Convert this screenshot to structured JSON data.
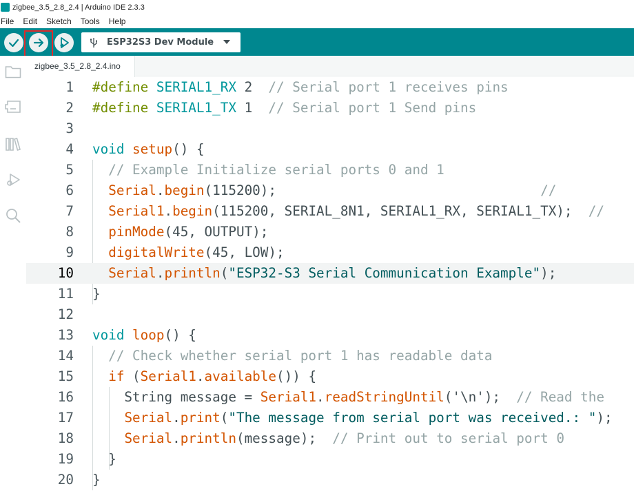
{
  "window": {
    "title": "zigbee_3.5_2.8_2.4 | Arduino IDE 2.3.3"
  },
  "menu": [
    "File",
    "Edit",
    "Sketch",
    "Tools",
    "Help"
  ],
  "toolbar": {
    "verify_icon": "checkmark-icon",
    "upload_icon": "arrow-right-icon",
    "debug_icon": "debug-play-icon",
    "board": "ESP32S3 Dev Module"
  },
  "sidebar": [
    "sketchbook-folder-icon",
    "boards-manager-icon",
    "library-manager-icon",
    "debug-icon",
    "search-icon"
  ],
  "tab": {
    "filename": "zigbee_3.5_2.8_2.4.ino"
  },
  "editor": {
    "active_line": 10,
    "lines": [
      {
        "n": "1",
        "tokens": [
          [
            "kw-pre",
            "#define "
          ],
          [
            "kw-const",
            "SERIAL1_RX"
          ],
          [
            "plain",
            " 2  "
          ],
          [
            "com",
            "// Serial port 1 receives pins"
          ]
        ]
      },
      {
        "n": "2",
        "tokens": [
          [
            "kw-pre",
            "#define "
          ],
          [
            "kw-const",
            "SERIAL1_TX"
          ],
          [
            "plain",
            " 1  "
          ],
          [
            "com",
            "// Serial port 1 Send pins"
          ]
        ]
      },
      {
        "n": "3",
        "tokens": []
      },
      {
        "n": "4",
        "tokens": [
          [
            "kw-type",
            "void "
          ],
          [
            "kw-fn",
            "setup"
          ],
          [
            "plain",
            "() {"
          ]
        ]
      },
      {
        "n": "5",
        "tokens": [
          [
            "plain",
            "  "
          ],
          [
            "com",
            "// Example Initialize serial ports 0 and 1"
          ]
        ]
      },
      {
        "n": "6",
        "tokens": [
          [
            "plain",
            "  "
          ],
          [
            "kw-fn",
            "Serial"
          ],
          [
            "plain",
            "."
          ],
          [
            "kw-fn",
            "begin"
          ],
          [
            "plain",
            "(115200);                                 "
          ],
          [
            "com",
            "//"
          ]
        ]
      },
      {
        "n": "7",
        "tokens": [
          [
            "plain",
            "  "
          ],
          [
            "kw-fn",
            "Serial1"
          ],
          [
            "plain",
            "."
          ],
          [
            "kw-fn",
            "begin"
          ],
          [
            "plain",
            "(115200, SERIAL_8N1, SERIAL1_RX, SERIAL1_TX);  "
          ],
          [
            "com",
            "//"
          ]
        ]
      },
      {
        "n": "8",
        "tokens": [
          [
            "plain",
            "  "
          ],
          [
            "kw-fn",
            "pinMode"
          ],
          [
            "plain",
            "(45, OUTPUT);"
          ]
        ]
      },
      {
        "n": "9",
        "tokens": [
          [
            "plain",
            "  "
          ],
          [
            "kw-fn",
            "digitalWrite"
          ],
          [
            "plain",
            "(45, LOW);"
          ]
        ]
      },
      {
        "n": "10",
        "tokens": [
          [
            "plain",
            "  "
          ],
          [
            "kw-fn",
            "Serial"
          ],
          [
            "plain",
            "."
          ],
          [
            "kw-fn",
            "println"
          ],
          [
            "plain",
            "("
          ],
          [
            "str",
            "\"ESP32-S3 Serial Communication Example\""
          ],
          [
            "plain",
            ");"
          ]
        ]
      },
      {
        "n": "11",
        "tokens": [
          [
            "plain",
            "}"
          ]
        ]
      },
      {
        "n": "12",
        "tokens": []
      },
      {
        "n": "13",
        "tokens": [
          [
            "kw-type",
            "void "
          ],
          [
            "kw-fn",
            "loop"
          ],
          [
            "plain",
            "() {"
          ]
        ]
      },
      {
        "n": "14",
        "tokens": [
          [
            "plain",
            "  "
          ],
          [
            "com",
            "// Check whether serial port 1 has readable data"
          ]
        ]
      },
      {
        "n": "15",
        "tokens": [
          [
            "plain",
            "  "
          ],
          [
            "kw-fn",
            "if"
          ],
          [
            "plain",
            " ("
          ],
          [
            "kw-fn",
            "Serial1"
          ],
          [
            "plain",
            "."
          ],
          [
            "kw-fn",
            "available"
          ],
          [
            "plain",
            "()) {"
          ]
        ]
      },
      {
        "n": "16",
        "tokens": [
          [
            "plain",
            "    String message = "
          ],
          [
            "kw-fn",
            "Serial1"
          ],
          [
            "plain",
            "."
          ],
          [
            "kw-fn",
            "readStringUntil"
          ],
          [
            "plain",
            "('\\n');  "
          ],
          [
            "com",
            "// Read the"
          ]
        ]
      },
      {
        "n": "17",
        "tokens": [
          [
            "plain",
            "    "
          ],
          [
            "kw-fn",
            "Serial"
          ],
          [
            "plain",
            "."
          ],
          [
            "kw-fn",
            "print"
          ],
          [
            "plain",
            "("
          ],
          [
            "str",
            "\"The message from serial port was received.: \""
          ],
          [
            "plain",
            ");"
          ]
        ]
      },
      {
        "n": "18",
        "tokens": [
          [
            "plain",
            "    "
          ],
          [
            "kw-fn",
            "Serial"
          ],
          [
            "plain",
            "."
          ],
          [
            "kw-fn",
            "println"
          ],
          [
            "plain",
            "(message);  "
          ],
          [
            "com",
            "// Print out to serial port 0"
          ]
        ]
      },
      {
        "n": "19",
        "tokens": [
          [
            "plain",
            "  }"
          ]
        ]
      },
      {
        "n": "20",
        "tokens": [
          [
            "plain",
            "}"
          ]
        ]
      }
    ]
  }
}
